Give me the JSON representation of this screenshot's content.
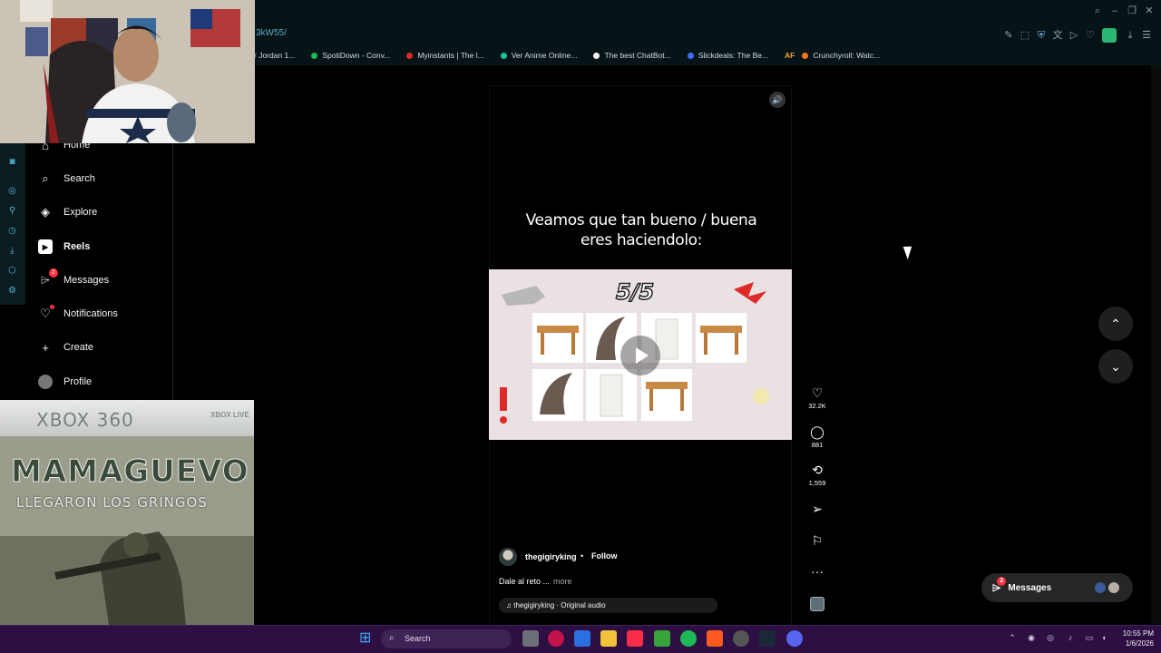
{
  "browser": {
    "url_fragment": "3kW55/",
    "bookmarks": [
      {
        "label": "r Jordan 1...",
        "color": "#b9b9b9"
      },
      {
        "label": "SpotiDown - Conv...",
        "color": "#1db954"
      },
      {
        "label": "Myinstants | The l...",
        "color": "#e0292b"
      },
      {
        "label": "Ver Anime Online...",
        "color": "#16c79a"
      },
      {
        "label": "The best ChatBot...",
        "color": "#ffffff"
      },
      {
        "label": "Slickdeals: The Be...",
        "color": "#3a6ff7"
      },
      {
        "label": "AF",
        "color": "#f2a33a"
      },
      {
        "label": "Crunchyroll: Watc...",
        "color": "#f47521"
      }
    ]
  },
  "nav": {
    "home": "Home",
    "search": "Search",
    "explore": "Explore",
    "reels": "Reels",
    "messages": "Messages",
    "messages_badge": "2",
    "notifications": "Notifications",
    "create": "Create",
    "profile": "Profile"
  },
  "cover": {
    "platform": "XBOX 360",
    "live": "XBOX LIVE",
    "title": "MAMAGUEVO",
    "subtitle": "LLEGARON LOS GRINGOS"
  },
  "reel": {
    "overlay_text": "Veamos que tan bueno / buena eres haciendolo:",
    "score": "5/5",
    "author": "thegigiryking",
    "separator": "•",
    "follow": "Follow",
    "caption": "Dale al reto ...",
    "more": "more",
    "audio": "thegigiryking · Original audio",
    "likes": "32.2K",
    "comments": "881",
    "reposts": "1,559"
  },
  "messages_pill": {
    "label": "Messages",
    "badge": "2"
  },
  "taskbar": {
    "search": "Search",
    "time": "10:55 PM",
    "date": "1/6/2026"
  },
  "icons": {
    "home": "home-icon",
    "search": "search-icon",
    "explore": "compass-icon",
    "reels": "reels-icon",
    "messages": "messenger-icon",
    "notifications": "heart-icon",
    "create": "plus-icon",
    "profile": "avatar"
  },
  "colors": {
    "taskbar": "#2d0f43",
    "chrome": "#061317",
    "badge": "#ff3040"
  }
}
